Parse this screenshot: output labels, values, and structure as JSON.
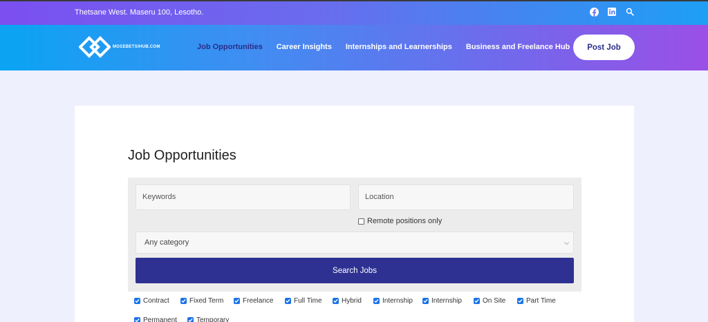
{
  "topbar": {
    "address": "Thetsane West. Maseru 100, Lesotho.",
    "icons": [
      "facebook-icon",
      "linkedin-icon",
      "search-icon"
    ]
  },
  "nav": {
    "logo_text": "MOSEBETSIHUB.COM",
    "links": [
      "Job Opportunities",
      "Career Insights",
      "Internships and Learnerships",
      "Business and Freelance Hub"
    ],
    "active_link": "Job Opportunities",
    "post_job_label": "Post Job"
  },
  "main": {
    "title": "Job Opportunities",
    "keywords_placeholder": "Keywords",
    "location_placeholder": "Location",
    "remote_label": "Remote positions only",
    "category_value": "Any category",
    "search_button_label": "Search Jobs",
    "job_types": [
      "Contract",
      "Fixed Term",
      "Freelance",
      "Full Time",
      "Hybrid",
      "Internship",
      "Internship",
      "On Site",
      "Part Time",
      "Permanent",
      "Temporary"
    ]
  },
  "colors": {
    "accent": "#2e3192",
    "checkbox": "#1a73e8"
  }
}
